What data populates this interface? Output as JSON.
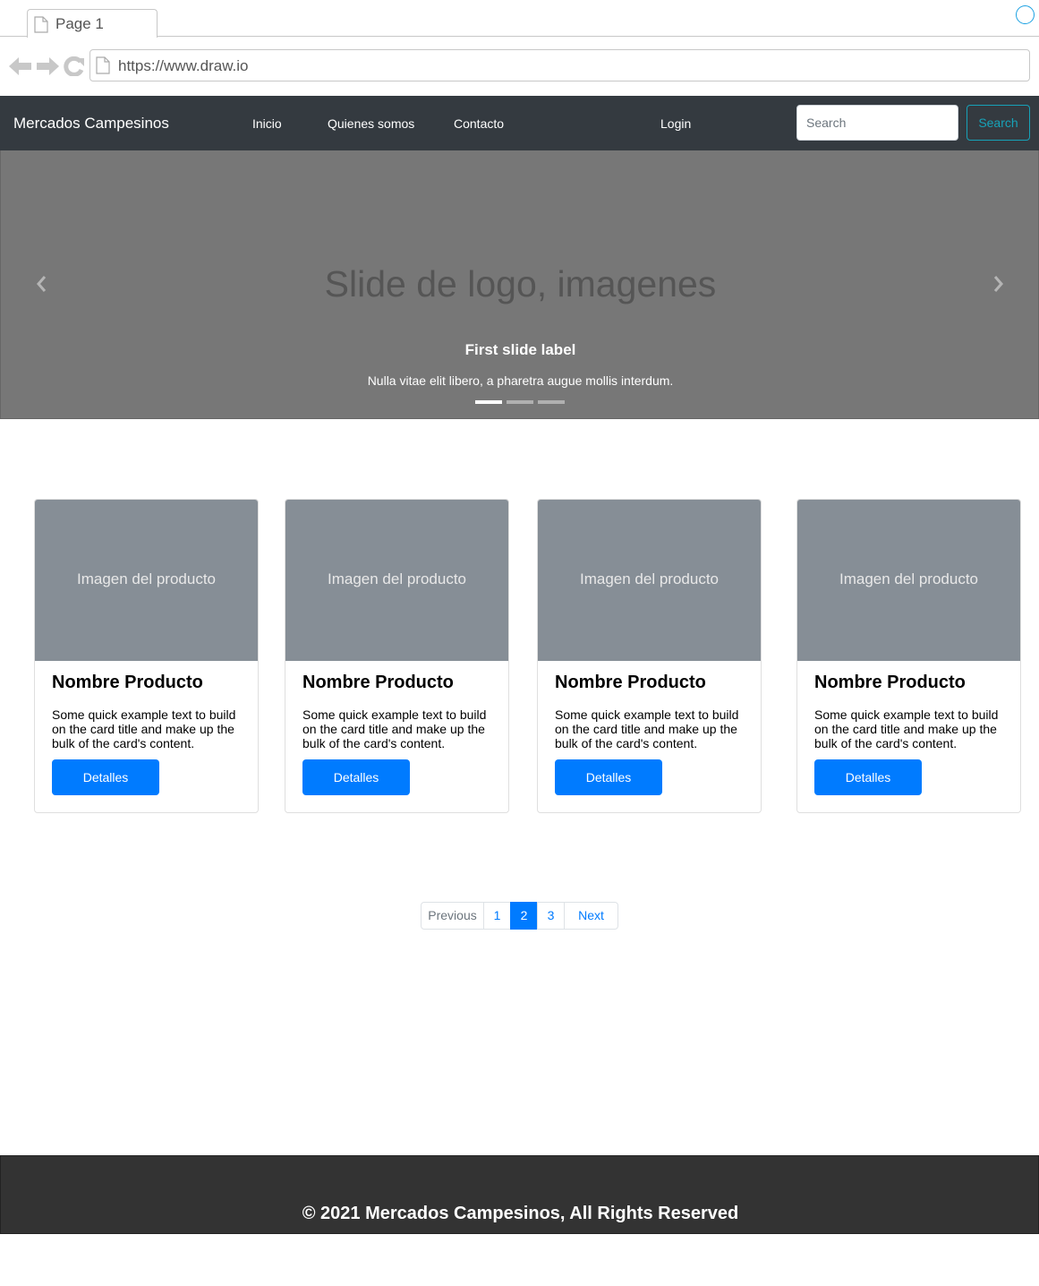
{
  "browser": {
    "tab_label": "Page 1",
    "url": "https://www.draw.io"
  },
  "navbar": {
    "brand": "Mercados Campesinos",
    "links": [
      "Inicio",
      "Quienes somos",
      "Contacto"
    ],
    "login": "Login",
    "search_placeholder": "Search",
    "search_button": "Search"
  },
  "carousel": {
    "slide_text": "Slide de logo, imagenes",
    "caption_title": "First slide label",
    "caption_text": "Nulla vitae elit libero, a pharetra augue mollis interdum.",
    "indicator_count": 3,
    "active_indicator": 1
  },
  "cards": [
    {
      "image_label": "Imagen del producto",
      "title": "Nombre Producto",
      "text": "Some quick example text to build on the card title and make up the bulk of the card's content.",
      "button": "Detalles"
    },
    {
      "image_label": "Imagen del producto",
      "title": "Nombre Producto",
      "text": "Some quick example text to build on the card title and make up the bulk of the card's content.",
      "button": "Detalles"
    },
    {
      "image_label": "Imagen del producto",
      "title": "Nombre Producto",
      "text": "Some quick example text to build on the card title and make up the bulk of the card's content.",
      "button": "Detalles"
    },
    {
      "image_label": "Imagen del producto",
      "title": "Nombre Producto",
      "text": "Some quick example text to build on the card title and make up the bulk of the card's content.",
      "button": "Detalles"
    }
  ],
  "pagination": {
    "previous": "Previous",
    "pages": [
      "1",
      "2",
      "3"
    ],
    "active_page": "2",
    "next": "Next"
  },
  "footer": {
    "copyright": "© 2021 Mercados Campesinos, All Rights Reserved"
  },
  "colors": {
    "navbar_bg": "#343a40",
    "carousel_bg": "#777777",
    "card_image_bg": "#868e96",
    "primary": "#007bff",
    "info": "#17a2b8",
    "footer_bg": "#333333"
  }
}
